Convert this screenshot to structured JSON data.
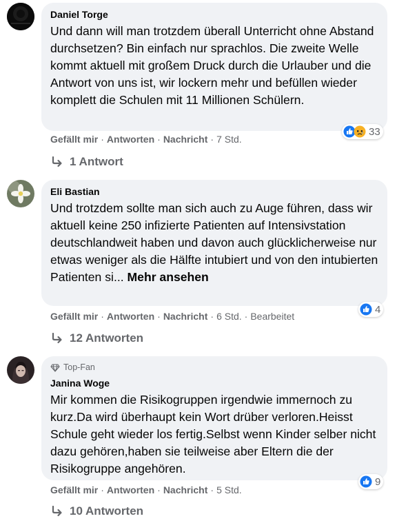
{
  "comments": [
    {
      "author": "Daniel Torge",
      "badge": "",
      "text": "Und dann will man trotzdem überall Unterricht ohne Abstand durchsetzen? Bin einfach nur sprachlos. Die zweite Welle kommt aktuell mit großem Druck durch die Urlauber und die Antwort von uns ist, wir lockern mehr und befüllen wieder komplett die Schulen mit 11 Millionen Schülern.",
      "see_more": "",
      "reaction_count": "33",
      "reaction_icons": [
        "like-icon",
        "sad-icon"
      ],
      "actions": {
        "like": "Gefällt mir",
        "reply": "Antworten",
        "message": "Nachricht",
        "time": "7 Std.",
        "edited": ""
      },
      "replies_label": "1 Antwort"
    },
    {
      "author": "Eli Bastian",
      "badge": "",
      "text": "Und trotzdem sollte man sich auch zu Auge führen, dass wir aktuell keine 250 infizierte Patienten auf Intensivstation deutschlandweit haben und davon auch glücklicherweise nur etwas weniger als die Hälfte intubiert und von den intubierten Patienten si...",
      "see_more": "Mehr ansehen",
      "reaction_count": "4",
      "reaction_icons": [
        "like-icon"
      ],
      "actions": {
        "like": "Gefällt mir",
        "reply": "Antworten",
        "message": "Nachricht",
        "time": "6 Std.",
        "edited": "Bearbeitet"
      },
      "replies_label": "12 Antworten"
    },
    {
      "author": "Janina Woge",
      "badge": "Top-Fan",
      "text": "Mir kommen die Risikogruppen irgendwie immernoch zu kurz.Da wird überhaupt kein Wort drüber verloren.Heisst Schule geht wieder los fertig.Selbst wenn Kinder selber nicht dazu gehören,haben sie teilweise aber Eltern die der Risikogruppe angehören.",
      "see_more": "",
      "reaction_count": "9",
      "reaction_icons": [
        "like-icon"
      ],
      "actions": {
        "like": "Gefällt mir",
        "reply": "Antworten",
        "message": "Nachricht",
        "time": "5 Std.",
        "edited": ""
      },
      "replies_label": "10 Antworten"
    }
  ],
  "colors": {
    "bubble": "#f0f2f5",
    "meta": "#65676b",
    "like": "#1877f2",
    "sad": "#f7b125"
  }
}
